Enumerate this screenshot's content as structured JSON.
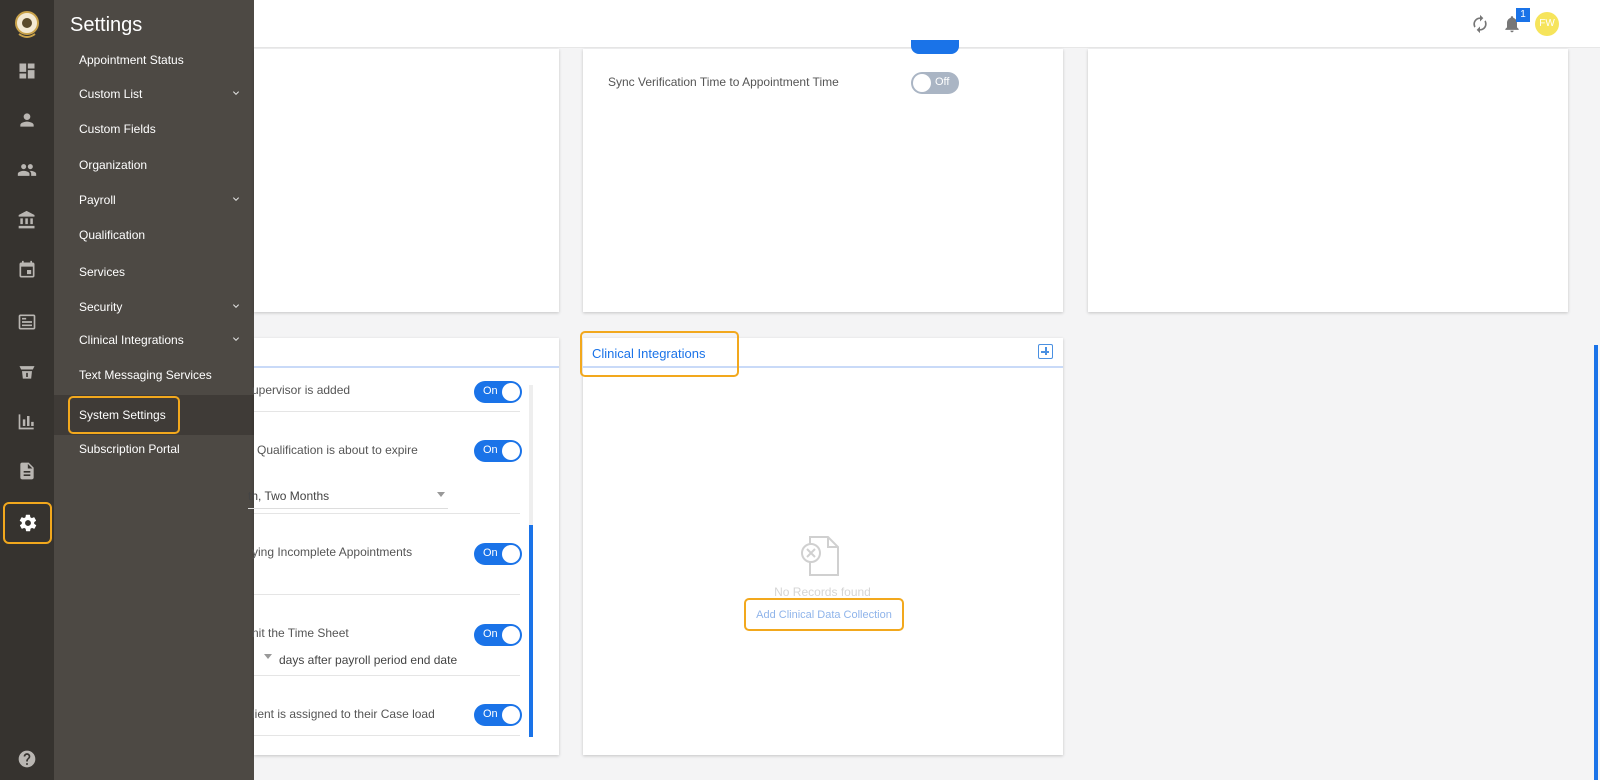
{
  "sidebar": {
    "rail_icons": [
      "logo-icon",
      "dashboard-icon",
      "person-icon",
      "people-icon",
      "bank-icon",
      "calendar-icon",
      "billing-icon",
      "payment-icon",
      "chart-icon",
      "document-icon",
      "gear-icon",
      "help-icon"
    ],
    "active_icon": "gear-icon"
  },
  "flyout": {
    "title": "Settings",
    "items": [
      {
        "label": "Appointment Status",
        "expandable": false
      },
      {
        "label": "Custom List",
        "expandable": true
      },
      {
        "label": "Custom Fields",
        "expandable": false
      },
      {
        "label": "Organization",
        "expandable": false
      },
      {
        "label": "Payroll",
        "expandable": true
      },
      {
        "label": "Qualification",
        "expandable": false
      },
      {
        "label": "Services",
        "expandable": false
      },
      {
        "label": "Security",
        "expandable": true
      },
      {
        "label": "Clinical Integrations",
        "expandable": true
      },
      {
        "label": "Text Messaging Services",
        "expandable": false
      },
      {
        "label": "System Settings",
        "expandable": false,
        "selected": true
      },
      {
        "label": "Subscription Portal",
        "expandable": false
      }
    ]
  },
  "topbar": {
    "notification_count": "1",
    "avatar_initials": "FW",
    "icons": [
      "refresh-icon",
      "bell-icon"
    ]
  },
  "top_middle_card": {
    "sync_label": "Sync Verification Time to Appointment Time",
    "sync_toggle": "Off"
  },
  "notifications_card": {
    "rows": [
      {
        "label": "upervisor is added",
        "toggle": "On"
      },
      {
        "label": "Qualification is about to expire",
        "toggle": "On"
      },
      {
        "label": "ying Incomplete Appointments",
        "toggle": "On"
      },
      {
        "label": "nit the Time Sheet",
        "toggle": "On"
      },
      {
        "label": "lient is assigned to their Case load",
        "toggle": "On"
      }
    ],
    "qualification_select": "th, Two Months",
    "payroll_days_text": "days after payroll period end date"
  },
  "clinical_card": {
    "title": "Clinical Integrations",
    "empty_text": "No Records found",
    "add_link": "Add Clinical Data Collection"
  },
  "colors": {
    "accent": "#1a73e8",
    "highlight": "#f2a81d",
    "rail_bg": "#36332f",
    "flyout_bg": "#4d4944"
  }
}
